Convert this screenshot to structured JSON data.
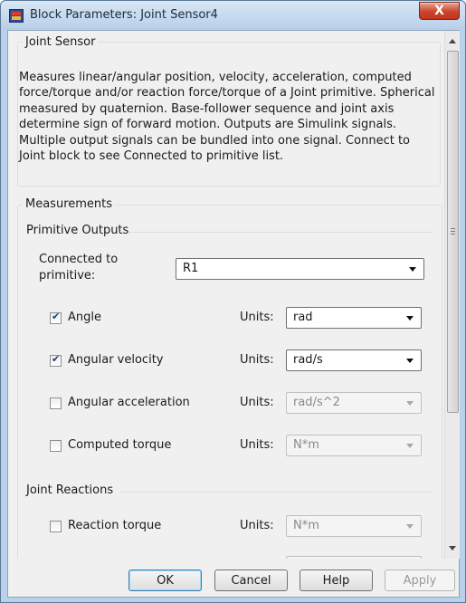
{
  "window": {
    "title": "Block Parameters: Joint Sensor4",
    "close_label": "X"
  },
  "block": {
    "group_title": "Joint Sensor",
    "description": "Measures linear/angular position, velocity, acceleration, computed force/torque and/or reaction force/torque of a Joint primitive. Spherical measured by quaternion. Base-follower sequence and joint axis determine sign of forward motion. Outputs are Simulink signals. Multiple output signals can be bundled into one signal. Connect to Joint block to see Connected to primitive list."
  },
  "measurements": {
    "title": "Measurements",
    "primitive_outputs": {
      "title": "Primitive Outputs",
      "connected_label_line1": "Connected to",
      "connected_label_line2": "primitive:",
      "connected_value": "R1",
      "rows": [
        {
          "label": "Angle",
          "checked": true,
          "units_label": "Units:",
          "units_value": "rad",
          "enabled": true
        },
        {
          "label": "Angular velocity",
          "checked": true,
          "units_label": "Units:",
          "units_value": "rad/s",
          "enabled": true
        },
        {
          "label": "Angular acceleration",
          "checked": false,
          "units_label": "Units:",
          "units_value": "rad/s^2",
          "enabled": false
        },
        {
          "label": "Computed torque",
          "checked": false,
          "units_label": "Units:",
          "units_value": "N*m",
          "enabled": false
        }
      ]
    },
    "joint_reactions": {
      "title": "Joint Reactions",
      "rows": [
        {
          "label": "Reaction torque",
          "checked": false,
          "units_label": "Units:",
          "units_value": "N*m",
          "enabled": false
        }
      ]
    }
  },
  "buttons": {
    "ok": "OK",
    "cancel": "Cancel",
    "help": "Help",
    "apply": "Apply"
  },
  "colors": {
    "title_gradient_top": "#d9e6f5",
    "close_red": "#c9452a",
    "dialog_bg": "#f0f0f0"
  }
}
